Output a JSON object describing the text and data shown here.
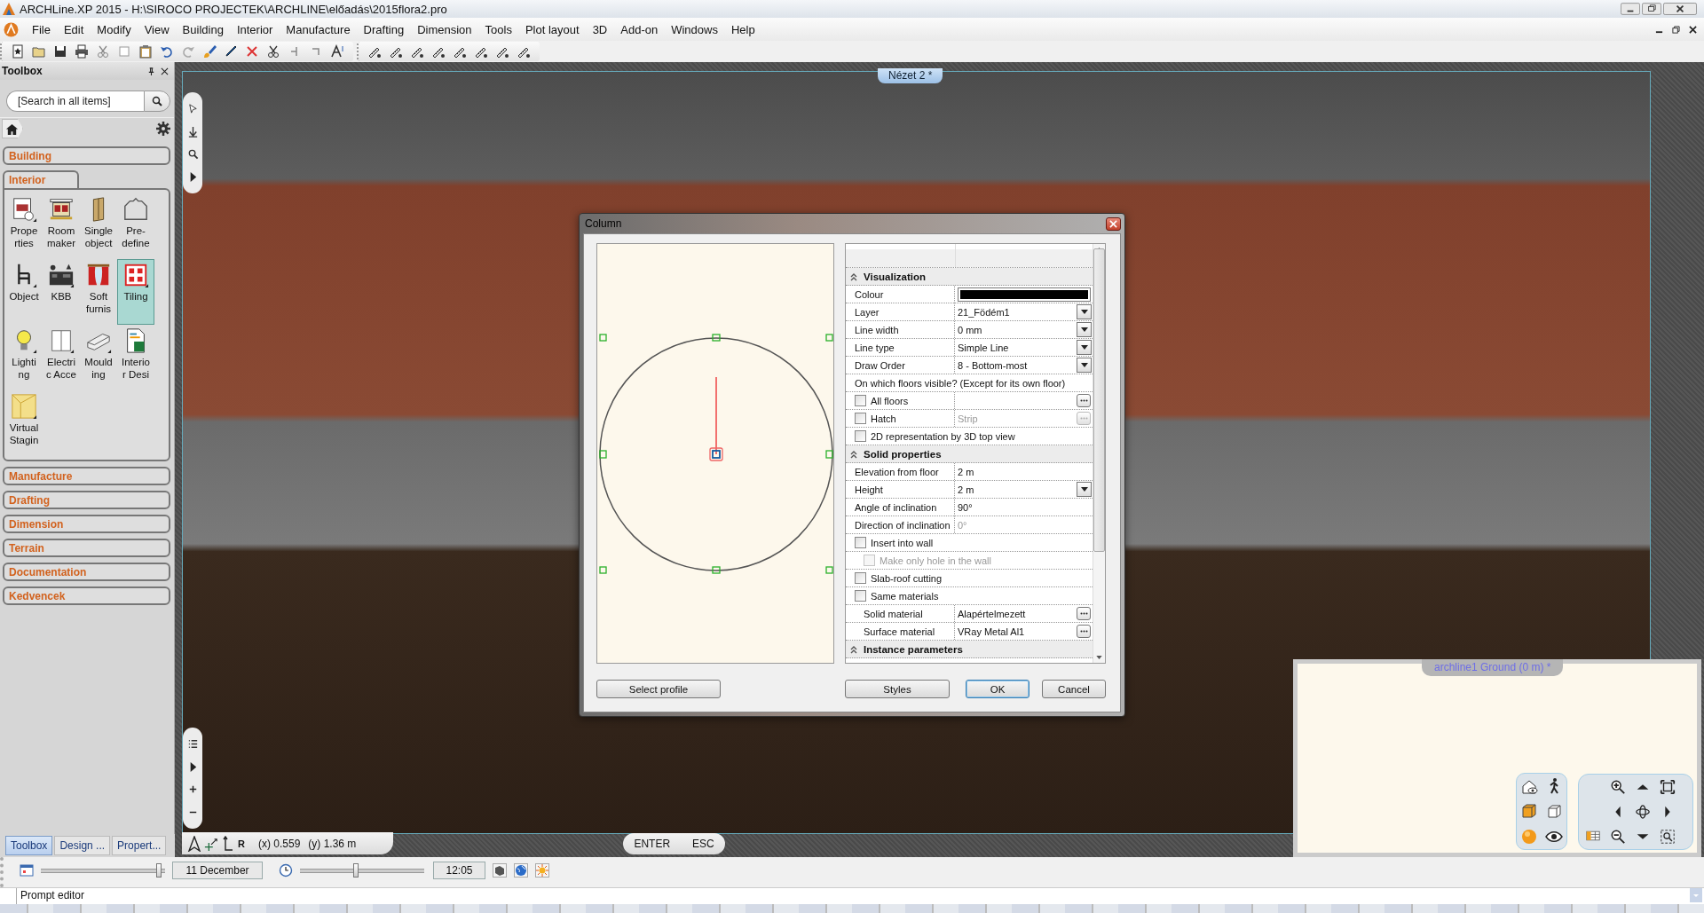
{
  "window": {
    "title": "ARCHLine.XP 2015 - H:\\SIROCO PROJECTEK\\ARCHLINE\\előadás\\2015flora2.pro"
  },
  "menu": [
    "File",
    "Edit",
    "Modify",
    "View",
    "Building",
    "Interior",
    "Manufacture",
    "Drafting",
    "Dimension",
    "Tools",
    "Plot layout",
    "3D",
    "Add-on",
    "Windows",
    "Help"
  ],
  "toolbox": {
    "title": "Toolbox",
    "search": {
      "placeholder": "[Search in all items]"
    },
    "sections": [
      {
        "label": "Building",
        "expanded": false
      },
      {
        "label": "Interior",
        "expanded": true,
        "items": [
          {
            "label": "Prope\nrties",
            "kind": "properties",
            "submenu": true,
            "selected": false
          },
          {
            "label": "Room\nmaker",
            "kind": "room",
            "submenu": false,
            "selected": false
          },
          {
            "label": "Single\nobject",
            "kind": "wardrobe",
            "submenu": false,
            "selected": false
          },
          {
            "label": "Pre-\ndefine",
            "kind": "outline",
            "submenu": false,
            "selected": false
          },
          {
            "label": "Object",
            "kind": "chair",
            "submenu": true,
            "selected": false
          },
          {
            "label": "KBB",
            "kind": "kitchen",
            "submenu": true,
            "selected": false
          },
          {
            "label": "Soft\nfurnis",
            "kind": "curtain",
            "submenu": false,
            "selected": false
          },
          {
            "label": "Tiling",
            "kind": "tiles",
            "submenu": true,
            "selected": true
          },
          {
            "label": "Lighti\nng",
            "kind": "bulb",
            "submenu": true,
            "selected": false
          },
          {
            "label": "Electri\nc Acce",
            "kind": "switch",
            "submenu": true,
            "selected": false
          },
          {
            "label": "Mould\ning",
            "kind": "moulding",
            "submenu": true,
            "selected": false
          },
          {
            "label": "Interio\nr Desi",
            "kind": "spreadsheet",
            "submenu": false,
            "selected": false
          },
          {
            "label": "Virtual\nStagin",
            "kind": "corner",
            "submenu": true,
            "selected": false
          }
        ]
      },
      {
        "label": "Manufacture",
        "expanded": false
      },
      {
        "label": "Drafting",
        "expanded": false
      },
      {
        "label": "Dimension",
        "expanded": false
      },
      {
        "label": "Terrain",
        "expanded": false
      },
      {
        "label": "Documentation",
        "expanded": false
      },
      {
        "label": "Kedvencek",
        "expanded": false
      }
    ]
  },
  "panel_tabs": [
    {
      "label": "Toolbox",
      "selected": true
    },
    {
      "label": "Design ...",
      "selected": false
    },
    {
      "label": "Propert...",
      "selected": false
    }
  ],
  "viewport": {
    "tab": "Nézet 2 *",
    "coordinates": {
      "relative_mark": "R",
      "x": "(x) 0.559",
      "y": "(y) 1.36 m"
    },
    "commands": [
      "ENTER",
      "ESC"
    ]
  },
  "plan_view": {
    "tab": "archline1 Ground (0 m) *"
  },
  "dialog": {
    "title": "Column",
    "profile_button": "Select profile",
    "property_grid": {
      "sections": [
        {
          "title": "Visualization",
          "expanded": true,
          "rows": [
            {
              "kind": "swatch",
              "label": "Colour",
              "color": "#000000",
              "disabled": false
            },
            {
              "kind": "dropdown",
              "label": "Layer",
              "value": "21_Födém1",
              "disabled": false
            },
            {
              "kind": "dropdown",
              "label": "Line width",
              "value": "0 mm",
              "disabled": false
            },
            {
              "kind": "dropdown",
              "label": "Line type",
              "value": "Simple Line",
              "disabled": false
            },
            {
              "kind": "dropdown",
              "label": "Draw Order",
              "value": "8 - Bottom-most",
              "disabled": false
            },
            {
              "kind": "note",
              "label": "On which floors visible? (Except for its own floor)",
              "disabled": false
            },
            {
              "kind": "check-value",
              "label": "All floors",
              "checked": false,
              "disabled": false
            },
            {
              "kind": "check-value",
              "label": "Hatch",
              "value": "Strip",
              "checked": false,
              "disabled": true
            },
            {
              "kind": "check",
              "label": "2D representation by 3D top view",
              "checked": false,
              "disabled": false
            }
          ]
        },
        {
          "title": "Solid properties",
          "expanded": true,
          "rows": [
            {
              "kind": "text",
              "label": "Elevation from floor",
              "value": "2 m",
              "disabled": false
            },
            {
              "kind": "dropdown",
              "label": "Height",
              "value": "2 m",
              "disabled": false
            },
            {
              "kind": "text",
              "label": "Angle of inclination",
              "value": "90°",
              "disabled": false
            },
            {
              "kind": "text",
              "label": "Direction of inclination",
              "value": "0°",
              "disabled": true
            },
            {
              "kind": "check",
              "label": "Insert into wall",
              "checked": false,
              "disabled": false,
              "children": [
                {
                  "kind": "check",
                  "label": "Make only hole in the wall",
                  "checked": false,
                  "disabled": true
                }
              ]
            },
            {
              "kind": "check",
              "label": "Slab-roof cutting",
              "checked": false,
              "disabled": false
            },
            {
              "kind": "check",
              "label": "Same materials",
              "checked": false,
              "disabled": false,
              "children": [
                {
                  "kind": "ellipsis",
                  "label": "Solid material",
                  "value": "Alapértelmezett",
                  "disabled": false
                },
                {
                  "kind": "ellipsis",
                  "label": "Surface material",
                  "value": "VRay Metal Al1",
                  "disabled": false
                }
              ]
            }
          ]
        },
        {
          "title": "Instance parameters",
          "expanded": true
        }
      ]
    },
    "buttons": [
      {
        "label": "Styles",
        "default": false
      },
      {
        "label": "OK",
        "default": true
      },
      {
        "label": "Cancel",
        "default": false
      }
    ]
  },
  "status_bar": {
    "date_slider": {
      "level": 0.95
    },
    "date": "11 December",
    "time_slider": {
      "level": 0.45
    },
    "time": "12:05"
  },
  "prompt_editor": {
    "label": "Prompt editor"
  }
}
